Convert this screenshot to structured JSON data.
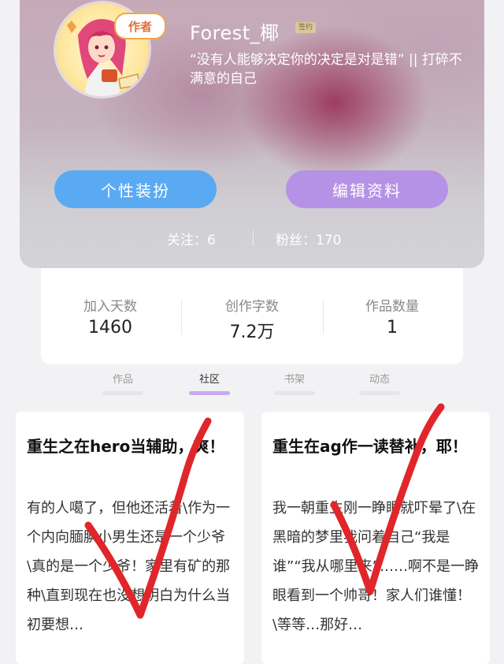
{
  "profile": {
    "author_tag": "作者",
    "username": "Forest_椰",
    "signed_badge": "签约",
    "bio": "“没有人能够决定你的决定是对是错” || 打碎不满意的自己",
    "dressup_button": "个性装扮",
    "edit_button": "编辑资料",
    "following": "关注：6",
    "fans": "粉丝：170"
  },
  "stats": [
    {
      "label": "加入天数",
      "value": "1460"
    },
    {
      "label": "创作字数",
      "value": "7.2万"
    },
    {
      "label": "作品数量",
      "value": "1"
    }
  ],
  "tabs": [
    {
      "label": "作品",
      "active": false
    },
    {
      "label": "社区",
      "active": true
    },
    {
      "label": "书架",
      "active": false
    },
    {
      "label": "动态",
      "active": false
    }
  ],
  "posts": [
    {
      "title": "重生之在hero当辅助，爽！",
      "body": "有的人噶了，但他还活着\\作为一个内向腼腆小男生还是一个少爷\\真的是一个少爷！家里有矿的那种\\直到现在也没想明白为什么当初要想…"
    },
    {
      "title": "重生在ag作一读替补，耶！",
      "body": "我一朝重生刚一睁眼就吓晕了\\在黑暗的梦里我问着自己“我是谁”“我从哪里来”……啊不是一睁眼看到一个帅哥！家人们谁懂！\\等等…那好…"
    }
  ],
  "colors": {
    "dressup_button": "#5aaaf3",
    "edit_button": "#b592e6",
    "active_tab_underline": "#c8aaf0",
    "check_mark": "#e0262a"
  }
}
